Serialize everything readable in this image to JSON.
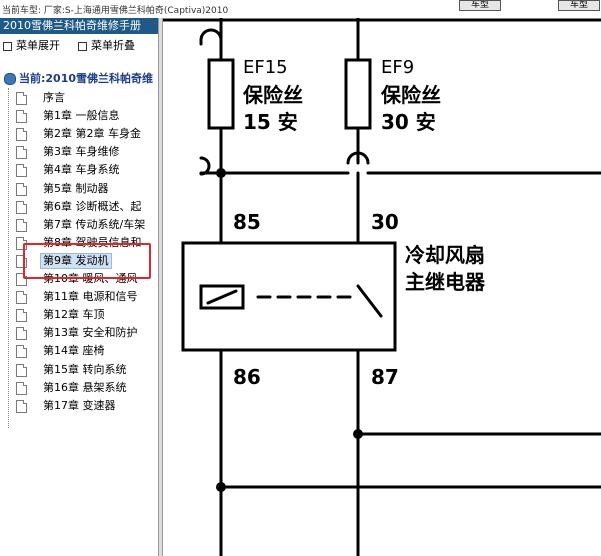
{
  "app": {
    "vehicle_info": "当前车型: 厂家:S-上海通用雪佛兰科帕奇(Captiva)2010",
    "btn_a": "车型",
    "btn_b": "车型"
  },
  "sidebar": {
    "title": "2010雪佛兰科帕奇维修手册",
    "expand": "菜单展开",
    "collapse": "菜单折叠",
    "root": "当前:2010雪佛兰科帕奇维",
    "items": [
      {
        "label": "序言"
      },
      {
        "label": "第1章 一般信息"
      },
      {
        "label": "第2章 第2章 车身金"
      },
      {
        "label": "第3章 车身维修"
      },
      {
        "label": "第4章 车身系统"
      },
      {
        "label": "第5章 制动器"
      },
      {
        "label": "第6章 诊断概述、起"
      },
      {
        "label": "第7章 传动系统/车架"
      },
      {
        "label": "第8章 驾驶员信息和"
      },
      {
        "label": "第9章 发动机"
      },
      {
        "label": "第10章 暖风、通风"
      },
      {
        "label": "第11章 电源和信号"
      },
      {
        "label": "第12章 车顶"
      },
      {
        "label": "第13章 安全和防护"
      },
      {
        "label": "第14章 座椅"
      },
      {
        "label": "第15章 转向系统"
      },
      {
        "label": "第16章 悬架系统"
      },
      {
        "label": "第17章 变速器"
      }
    ],
    "selected_index": 9
  },
  "diagram": {
    "fuse1_name": "EF15",
    "fuse1_type": "保险丝",
    "fuse1_rating": "15 安",
    "fuse2_name": "EF9",
    "fuse2_type": "保险丝",
    "fuse2_rating": "30 安",
    "pin_85": "85",
    "pin_30": "30",
    "pin_86": "86",
    "pin_87": "87",
    "relay_line1": "冷却风扇",
    "relay_line2": "主继电器"
  }
}
